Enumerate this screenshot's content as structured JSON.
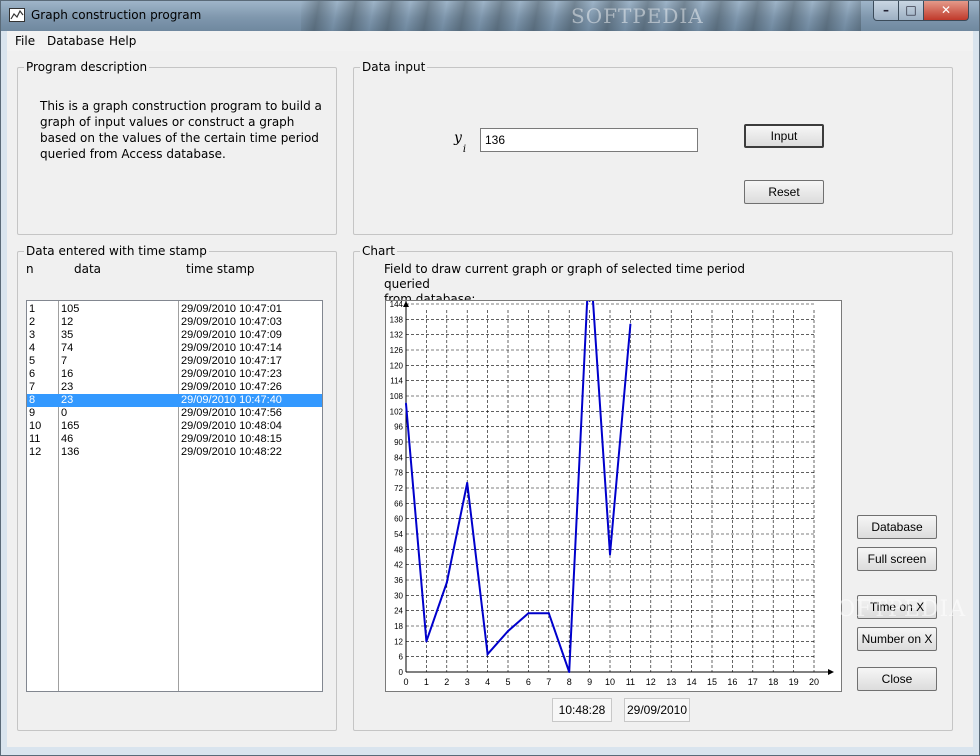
{
  "window": {
    "title": "Graph construction program",
    "watermark": "SOFTPEDIA",
    "controls": {
      "minimize": "–",
      "maximize": "□",
      "close": "✕"
    }
  },
  "menu": {
    "file": "File",
    "database": "Database",
    "help": "Help"
  },
  "program_description": {
    "title": "Program description",
    "text": "This is a graph construction program to build a graph of input values or construct a graph based on the values of the certain time period queried from Access database."
  },
  "data_input": {
    "title": "Data input",
    "label_main": "y",
    "label_sub": "i",
    "value": "136",
    "input_button": "Input",
    "reset_button": "Reset"
  },
  "data_list": {
    "title": "Data entered with time stamp",
    "headers": {
      "n": "n",
      "data": "data",
      "time_stamp": "time stamp"
    },
    "selected_index": 7,
    "rows": [
      {
        "n": "1",
        "data": "105",
        "time": "29/09/2010 10:47:01"
      },
      {
        "n": "2",
        "data": "12",
        "time": "29/09/2010 10:47:03"
      },
      {
        "n": "3",
        "data": "35",
        "time": "29/09/2010 10:47:09"
      },
      {
        "n": "4",
        "data": "74",
        "time": "29/09/2010 10:47:14"
      },
      {
        "n": "5",
        "data": "7",
        "time": "29/09/2010 10:47:17"
      },
      {
        "n": "6",
        "data": "16",
        "time": "29/09/2010 10:47:23"
      },
      {
        "n": "7",
        "data": "23",
        "time": "29/09/2010 10:47:26"
      },
      {
        "n": "8",
        "data": "23",
        "time": "29/09/2010 10:47:40"
      },
      {
        "n": "9",
        "data": "0",
        "time": "29/09/2010 10:47:56"
      },
      {
        "n": "10",
        "data": "165",
        "time": "29/09/2010 10:48:04"
      },
      {
        "n": "11",
        "data": "46",
        "time": "29/09/2010 10:48:15"
      },
      {
        "n": "12",
        "data": "136",
        "time": "29/09/2010 10:48:22"
      }
    ]
  },
  "chart": {
    "title": "Chart",
    "caption_line1": "Field to draw current graph or graph of selected time period queried",
    "caption_line2": "from database:",
    "time": "10:48:28",
    "date": "29/09/2010"
  },
  "buttons": {
    "database": "Database",
    "full_screen": "Full screen",
    "time_on_x": "Time on X",
    "number_on_x": "Number on X",
    "close": "Close"
  },
  "chart_data": {
    "type": "line",
    "line_color": "#0000cc",
    "grid": true,
    "x": [
      0,
      1,
      2,
      3,
      4,
      5,
      6,
      7,
      8,
      9,
      10,
      11
    ],
    "values": [
      105,
      12,
      35,
      74,
      7,
      16,
      23,
      23,
      0,
      165,
      46,
      136
    ],
    "xlim": [
      0,
      20
    ],
    "ylim": [
      0,
      144
    ],
    "x_ticks": [
      "0",
      "1",
      "2",
      "3",
      "4",
      "5",
      "6",
      "7",
      "8",
      "9",
      "10",
      "11",
      "12",
      "13",
      "14",
      "15",
      "16",
      "17",
      "18",
      "19",
      "20"
    ],
    "y_ticks": [
      "0",
      "6",
      "12",
      "18",
      "24",
      "30",
      "36",
      "42",
      "48",
      "54",
      "60",
      "66",
      "72",
      "78",
      "84",
      "90",
      "96",
      "102",
      "108",
      "114",
      "120",
      "126",
      "132",
      "138",
      "144"
    ]
  }
}
